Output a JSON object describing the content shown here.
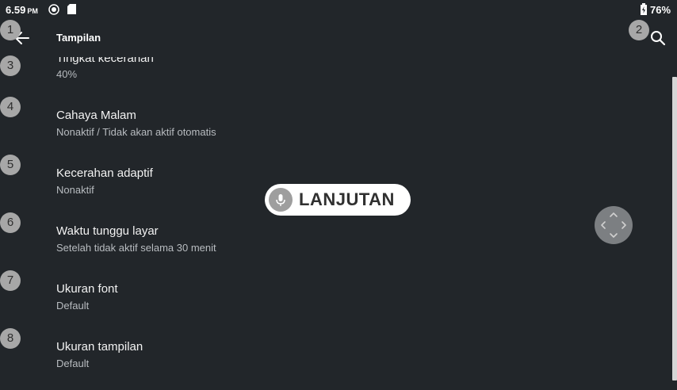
{
  "status_bar": {
    "time": "6.59",
    "ampm": "PM",
    "battery": "76%"
  },
  "toolbar": {
    "title": "Tampilan",
    "back_icon": "arrow-back-icon",
    "search_icon": "search-icon"
  },
  "settings": [
    {
      "title": "Tingkat kecerahan",
      "subtitle": "40%"
    },
    {
      "title": "Cahaya Malam",
      "subtitle": "Nonaktif / Tidak akan aktif otomatis"
    },
    {
      "title": "Kecerahan adaptif",
      "subtitle": "Nonaktif"
    },
    {
      "title": "Waktu tunggu layar",
      "subtitle": "Setelah tidak aktif selama 30 menit"
    },
    {
      "title": "Ukuran font",
      "subtitle": "Default"
    },
    {
      "title": "Ukuran tampilan",
      "subtitle": "Default"
    }
  ],
  "badges": [
    "1",
    "2",
    "3",
    "4",
    "5",
    "6",
    "7",
    "8"
  ],
  "overlay": {
    "label": "LANJUTAN",
    "icon": "microphone-icon"
  },
  "dpad_icon": "dpad-icon",
  "colors": {
    "background": "#22262a",
    "badge": "#a7a7a7",
    "subtitle": "#b8bcc0"
  }
}
